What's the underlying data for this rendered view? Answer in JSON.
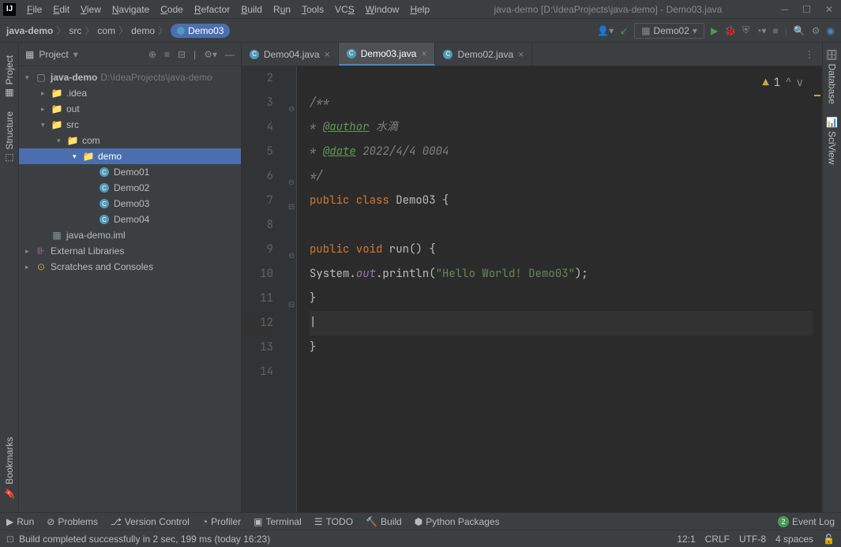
{
  "title": "java-demo [D:\\IdeaProjects\\java-demo] - Demo03.java",
  "menu": [
    "File",
    "Edit",
    "View",
    "Navigate",
    "Code",
    "Refactor",
    "Build",
    "Run",
    "Tools",
    "VCS",
    "Window",
    "Help"
  ],
  "breadcrumb": {
    "root": "java-demo",
    "parts": [
      "src",
      "com",
      "demo"
    ],
    "current": "Demo03"
  },
  "runConfig": "Demo02",
  "projectPanel": {
    "label": "Project"
  },
  "tree": {
    "root": {
      "name": "java-demo",
      "path": "D:\\IdeaProjects\\java-demo"
    },
    "idea": ".idea",
    "out": "out",
    "src": "src",
    "com": "com",
    "demo": "demo",
    "files": [
      "Demo01",
      "Demo02",
      "Demo03",
      "Demo04"
    ],
    "iml": "java-demo.iml",
    "libs": "External Libraries",
    "scratches": "Scratches and Consoles"
  },
  "tabs": [
    {
      "name": "Demo04.java",
      "active": false
    },
    {
      "name": "Demo03.java",
      "active": true
    },
    {
      "name": "Demo02.java",
      "active": false
    }
  ],
  "indicator": {
    "warn": "1"
  },
  "code": {
    "lines": [
      "2",
      "3",
      "4",
      "5",
      "6",
      "7",
      "8",
      "9",
      "10",
      "11",
      "12",
      "13",
      "14"
    ],
    "l3": "/**",
    "l4_tag": "@author",
    "l4_txt": " 水滴",
    "l5_tag": "@date",
    "l5_txt": " 2022/4/4 0004",
    "l6": " */",
    "l7_kw1": "public class",
    "l7_name": " Demo03 ",
    "l7_br": "{",
    "l9_kw": "public void",
    "l9_name": " run() {",
    "l10_sys": "System.",
    "l10_out": "out",
    "l10_pr": ".println(",
    "l10_str": "\"Hello World! Demo03\"",
    "l10_end": ");",
    "l11": "    }",
    "l13": "}"
  },
  "leftTabs": {
    "project": "Project",
    "structure": "Structure",
    "bookmarks": "Bookmarks"
  },
  "rightTabs": {
    "database": "Database",
    "sciview": "SciView"
  },
  "bottomTabs": [
    "Run",
    "Problems",
    "Version Control",
    "Profiler",
    "Terminal",
    "TODO",
    "Build",
    "Python Packages"
  ],
  "eventLog": "Event Log",
  "status": {
    "msg": "Build completed successfully in 2 sec, 199 ms (today 16:23)",
    "pos": "12:1",
    "sep": "CRLF",
    "enc": "UTF-8",
    "indent": "4 spaces"
  }
}
